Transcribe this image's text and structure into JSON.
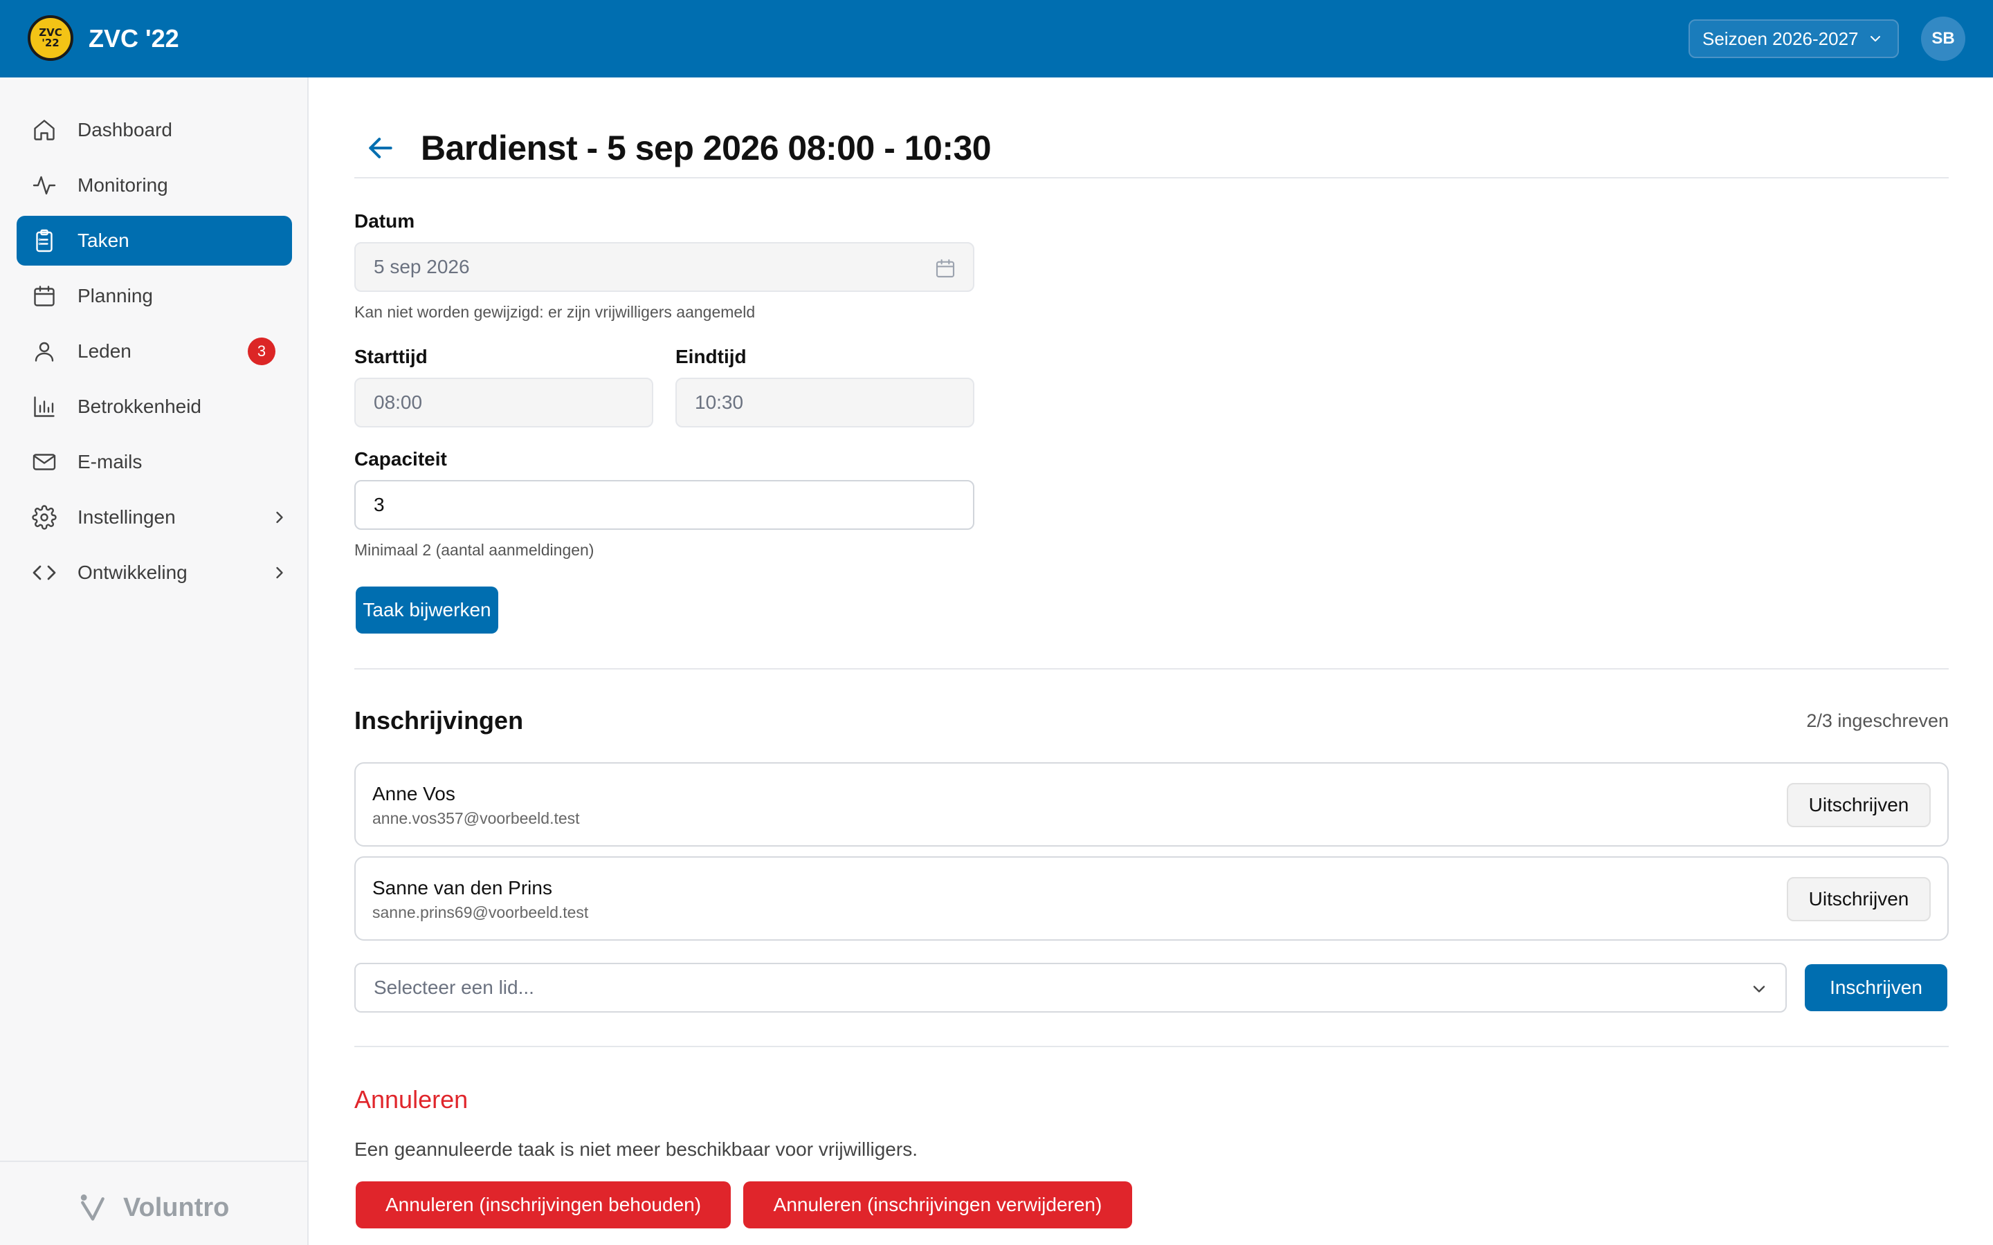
{
  "header": {
    "logo_text": "ZVC '22",
    "club_name": "ZVC '22",
    "season_select": "Seizoen 2026-2027",
    "avatar_initials": "SB"
  },
  "sidebar": {
    "items": [
      {
        "label": "Dashboard",
        "icon": "home-icon"
      },
      {
        "label": "Monitoring",
        "icon": "activity-icon"
      },
      {
        "label": "Taken",
        "icon": "clipboard-icon",
        "active": true
      },
      {
        "label": "Planning",
        "icon": "calendar-icon"
      },
      {
        "label": "Leden",
        "icon": "user-icon",
        "badge": "3"
      },
      {
        "label": "Betrokkenheid",
        "icon": "bar-chart-icon"
      },
      {
        "label": "E-mails",
        "icon": "mail-icon"
      },
      {
        "label": "Instellingen",
        "icon": "gear-icon",
        "expandable": true
      },
      {
        "label": "Ontwikkeling",
        "icon": "code-icon",
        "expandable": true
      }
    ],
    "brand": "Voluntro"
  },
  "page": {
    "title": "Bardienst - 5 sep 2026 08:00 - 10:30"
  },
  "form": {
    "date_label": "Datum",
    "date_value": "5 sep 2026",
    "date_hint": "Kan niet worden gewijzigd: er zijn vrijwilligers aangemeld",
    "start_label": "Starttijd",
    "start_value": "08:00",
    "end_label": "Eindtijd",
    "end_value": "10:30",
    "capacity_label": "Capaciteit",
    "capacity_value": "3",
    "capacity_hint": "Minimaal 2 (aantal aanmeldingen)",
    "submit_label": "Taak bijwerken"
  },
  "registrations": {
    "title": "Inschrijvingen",
    "count_text": "2/3 ingeschreven",
    "items": [
      {
        "name": "Anne Vos",
        "email": "anne.vos357@voorbeeld.test",
        "action": "Uitschrijven"
      },
      {
        "name": "Sanne van den Prins",
        "email": "sanne.prins69@voorbeeld.test",
        "action": "Uitschrijven"
      }
    ],
    "select_placeholder": "Selecteer een lid...",
    "register_label": "Inschrijven"
  },
  "cancel": {
    "title": "Annuleren",
    "text": "Een geannuleerde taak is niet meer beschikbaar voor vrijwilligers.",
    "keep_label": "Annuleren (inschrijvingen behouden)",
    "remove_label": "Annuleren (inschrijvingen verwijderen)"
  },
  "colors": {
    "primary": "#006eb0",
    "danger": "#e0252b",
    "badge": "#dc2626",
    "logo": "#f3c316"
  }
}
